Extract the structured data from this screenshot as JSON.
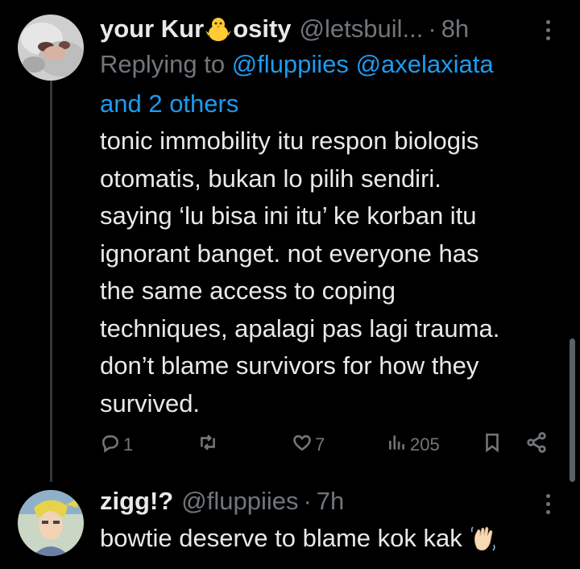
{
  "tweet": {
    "author_name_part1": "your Kur",
    "author_name_part2": "osity",
    "author_handle": "@letsbuil...",
    "separator": "·",
    "time": "8h",
    "replying_prefix": "Replying to",
    "mention_1": "@fluppiies",
    "mention_2": "@axelaxiata",
    "mention_more": "and 2 others",
    "text": "tonic immobility itu respon biologis\notomatis, bukan lo pilih sendiri.\nsaying ‘lu bisa ini itu’ ke korban itu\nignorant banget. not everyone has\nthe same access to coping\ntechniques, apalagi pas lagi trauma.\ndon’t blame survivors for how they\nsurvived.",
    "actions": {
      "replies": "1",
      "retweets": "",
      "likes": "7",
      "views": "205"
    }
  },
  "reply": {
    "author_name": "zigg!?",
    "author_handle": "@fluppiies",
    "separator": "·",
    "time": "7h",
    "text": "bowtie deserve to blame kok kak"
  },
  "icons": [
    "more-vertical-icon",
    "reply-icon",
    "retweet-icon",
    "like-icon",
    "views-icon",
    "bookmark-icon",
    "share-icon",
    "chick-emoji",
    "waving-hand-emoji"
  ]
}
